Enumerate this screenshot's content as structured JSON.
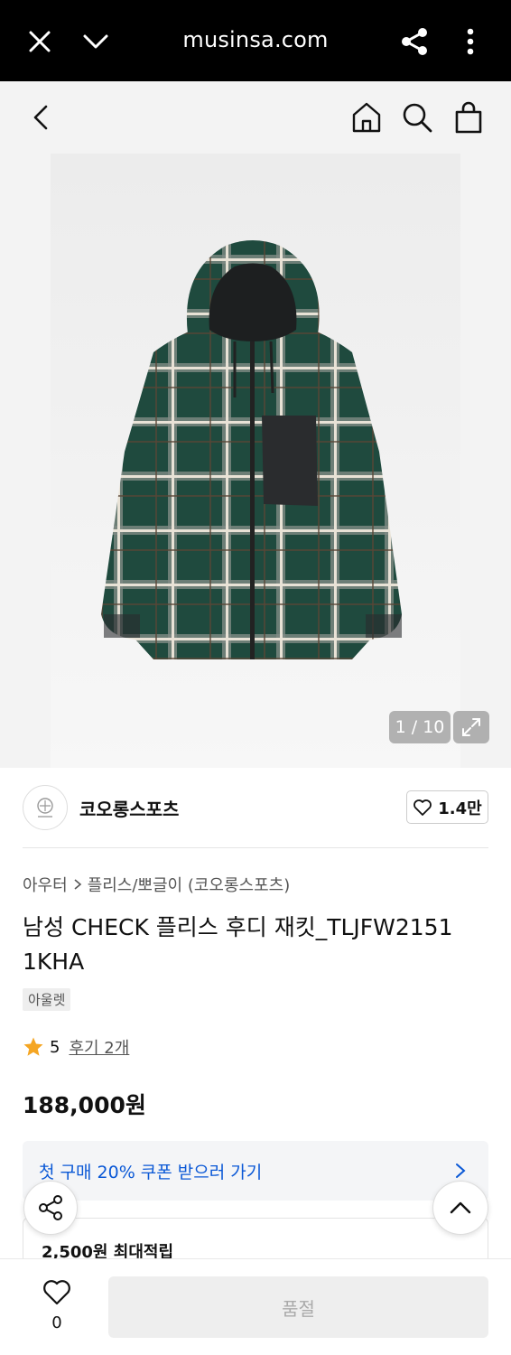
{
  "browser": {
    "url": "musinsa.com",
    "icons": [
      "close-icon",
      "chevron-down-icon",
      "share-icon",
      "more-vert-icon"
    ]
  },
  "nav": {
    "icons": [
      "back-arrow-icon",
      "home-icon",
      "search-icon",
      "shopping-bag-icon"
    ]
  },
  "gallery": {
    "counter": "1 / 10"
  },
  "brand": {
    "name": "코오롱스포츠",
    "likes": "1.4만"
  },
  "breadcrumb": {
    "category": "아우터",
    "subcategory": "플리스/뽀글이 (코오롱스포츠)"
  },
  "product": {
    "title": "남성 CHECK 플리스 후디 재킷_TLJFW2151 1KHA",
    "badge": "아울렛",
    "rating": "5",
    "reviews": "후기 2개",
    "price": "188,000원"
  },
  "coupon": {
    "label": "첫 구매 20% 쿠폰 받으러 가기"
  },
  "points": {
    "label": "2,500원 최대적립"
  },
  "bottom": {
    "wish_count": "0",
    "buy_label": "품절"
  },
  "colors": {
    "accent_blue": "#0a58d6",
    "star": "#f5a623",
    "jacket_green": "#1f4a3e"
  }
}
